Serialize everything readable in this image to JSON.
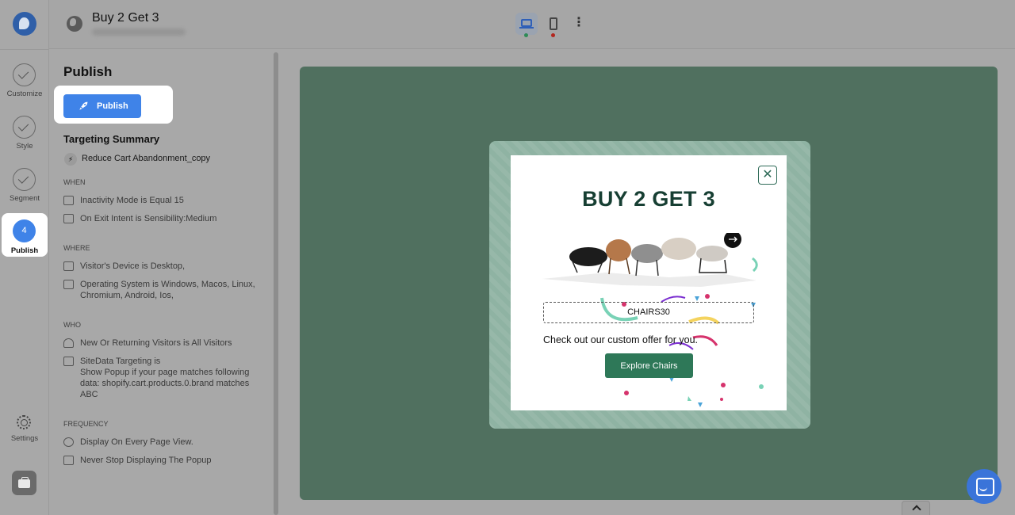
{
  "header": {
    "campaign_title": "Buy 2 Get 3"
  },
  "rail": {
    "steps": [
      {
        "label": "Customize"
      },
      {
        "label": "Style"
      },
      {
        "label": "Segment"
      },
      {
        "label": "Publish",
        "number": "4"
      }
    ],
    "settings_label": "Settings"
  },
  "panel": {
    "title": "Publish",
    "publish_button": "Publish",
    "targeting_title": "Targeting Summary",
    "campaign_name": "Reduce Cart Abandonment_copy",
    "sections": {
      "when": {
        "label": "WHEN",
        "rows": [
          "Inactivity Mode is Equal 15",
          "On Exit Intent is Sensibility:Medium"
        ]
      },
      "where": {
        "label": "WHERE",
        "rows": [
          "Visitor's Device is Desktop,",
          "Operating System is Windows, Macos, Linux, Chromium, Android, Ios,"
        ]
      },
      "who": {
        "label": "WHO",
        "rows": [
          "New Or Returning Visitors is All Visitors",
          "SiteData Targeting is",
          "Show Popup if your page matches following data: shopify.cart.products.0.brand matches ABC"
        ]
      },
      "frequency": {
        "label": "FREQUENCY",
        "rows": [
          "Display On Every Page View.",
          "Never Stop Displaying The Popup"
        ]
      }
    }
  },
  "popup": {
    "headline": "BUY 2 GET 3",
    "coupon_code": "CHAIRS30",
    "offer_text": "Check out our custom offer for you.",
    "cta_label": "Explore Chairs",
    "close_glyph": "✕"
  },
  "colors": {
    "accent": "#3f83e8",
    "canvas_bg": "#50705f",
    "cta_bg": "#2e7858",
    "headline": "#173f33"
  }
}
